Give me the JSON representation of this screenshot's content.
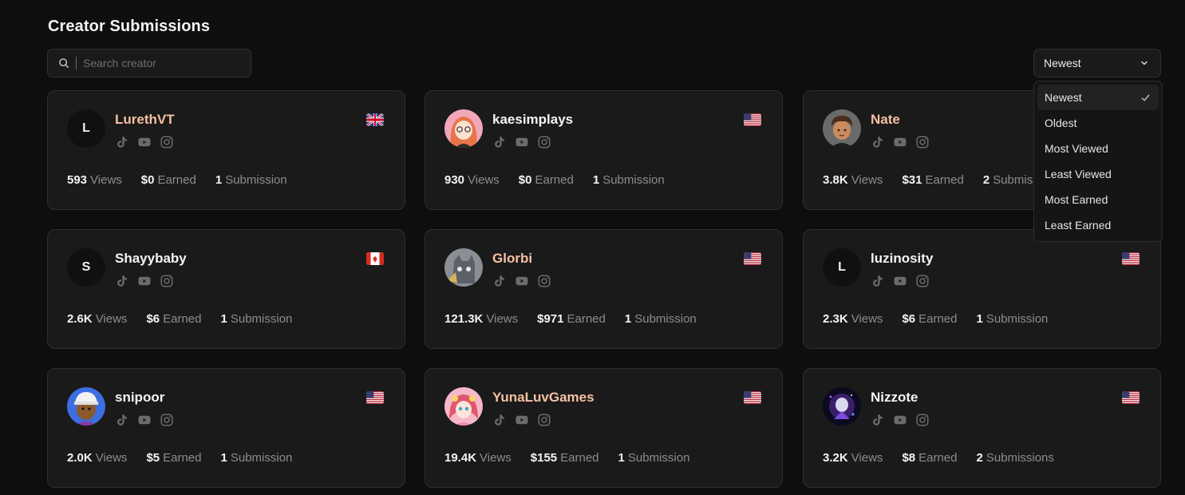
{
  "page": {
    "title": "Creator Submissions"
  },
  "search": {
    "placeholder": "Search creator",
    "value": ""
  },
  "sort": {
    "selected": "Newest",
    "options": [
      "Newest",
      "Oldest",
      "Most Viewed",
      "Least Viewed",
      "Most Earned",
      "Least Earned"
    ]
  },
  "labels": {
    "views": "Views",
    "earned": "Earned"
  },
  "colors": {
    "accent_name": "#f7c1a2",
    "background": "#0e0e0e",
    "card": "#1a1a1a"
  },
  "creators": [
    {
      "name": "LurethVT",
      "initial": "L",
      "name_color": "peach",
      "flag": "uk-flag",
      "views": "593",
      "earned": "$0",
      "submissions": "1",
      "submissions_label": "Submission"
    },
    {
      "name": "kaesimplays",
      "initial": "",
      "name_color": "white",
      "flag": "us-flag",
      "views": "930",
      "earned": "$0",
      "submissions": "1",
      "submissions_label": "Submission"
    },
    {
      "name": "Nate",
      "initial": "",
      "name_color": "peach",
      "flag": "us-flag",
      "views": "3.8K",
      "earned": "$31",
      "submissions": "2",
      "submissions_label": "Submissions"
    },
    {
      "name": "Shayybaby",
      "initial": "S",
      "name_color": "white",
      "flag": "canada-flag",
      "views": "2.6K",
      "earned": "$6",
      "submissions": "1",
      "submissions_label": "Submission"
    },
    {
      "name": "Glorbi",
      "initial": "",
      "name_color": "peach",
      "flag": "us-flag",
      "views": "121.3K",
      "earned": "$971",
      "submissions": "1",
      "submissions_label": "Submission"
    },
    {
      "name": "luzinosity",
      "initial": "L",
      "name_color": "white",
      "flag": "us-flag",
      "views": "2.3K",
      "earned": "$6",
      "submissions": "1",
      "submissions_label": "Submission"
    },
    {
      "name": "snipoor",
      "initial": "",
      "name_color": "white",
      "flag": "us-flag",
      "views": "2.0K",
      "earned": "$5",
      "submissions": "1",
      "submissions_label": "Submission"
    },
    {
      "name": "YunaLuvGames",
      "initial": "",
      "name_color": "peach",
      "flag": "us-flag",
      "views": "19.4K",
      "earned": "$155",
      "submissions": "1",
      "submissions_label": "Submission"
    },
    {
      "name": "Nizzote",
      "initial": "",
      "name_color": "white",
      "flag": "us-flag",
      "views": "3.2K",
      "earned": "$8",
      "submissions": "2",
      "submissions_label": "Submissions"
    }
  ]
}
